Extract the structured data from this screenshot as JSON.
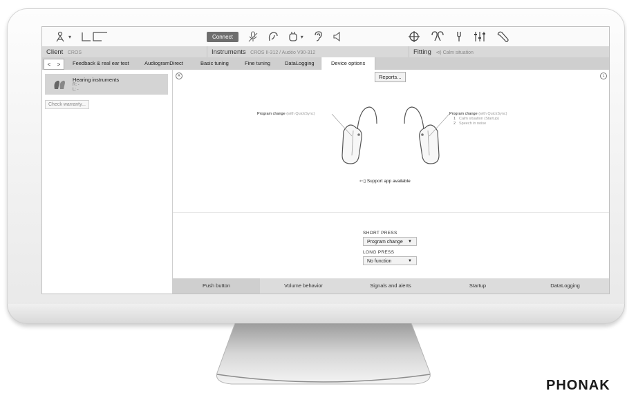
{
  "toolbar": {
    "connect_label": "Connect",
    "left_icons": [
      "remote-support-icon",
      "dropdown-arrow",
      "logo-mark"
    ],
    "center_icons": [
      "microphone-icon",
      "receiver-icon",
      "hearing-aid-icon",
      "ear-icon",
      "speaker-icon"
    ],
    "right_icons": [
      "target-icon",
      "ears-icon",
      "tuning-fork-icon",
      "mixer-icon",
      "wrench-icon"
    ]
  },
  "infobar": {
    "client_label": "Client",
    "client_value": "CROS",
    "instruments_label": "Instruments",
    "instruments_value": "CROS II-312 / Audéo V90-312",
    "fitting_label": "Fitting",
    "fitting_value": "Calm situation"
  },
  "tabs": [
    "Feedback & real ear test",
    "AudiogramDirect",
    "Basic tuning",
    "Fine tuning",
    "DataLogging",
    "Device options"
  ],
  "active_tab": "Device options",
  "sidebar": {
    "card_title": "Hearing instruments",
    "card_right": "R: -",
    "card_left": "L: -",
    "warranty_button": "Check warranty..."
  },
  "main": {
    "right_marker": "R",
    "left_marker": "L",
    "reports_button": "Reports...",
    "left_callout_main": "Program change",
    "left_callout_sub": "(with QuickSync)",
    "right_callout_main": "Program change",
    "right_callout_sub": "(with QuickSync)",
    "right_programs": [
      {
        "num": "1",
        "label": "Calm situation (Startup)"
      },
      {
        "num": "2",
        "label": "Speech in noise"
      }
    ],
    "support_text": "Support app available",
    "short_press_label": "SHORT PRESS",
    "short_press_value": "Program change",
    "long_press_label": "LONG PRESS",
    "long_press_value": "No function"
  },
  "bottom_tabs": [
    "Push button",
    "Volume behavior",
    "Signals and alerts",
    "Startup",
    "DataLogging"
  ],
  "active_bottom_tab": "Push button",
  "brand": "PHONAK",
  "colors": {
    "tab_bar": "#cfcfcf",
    "info_bar": "#d9d9d9",
    "connect_button": "#6e6e6e"
  }
}
